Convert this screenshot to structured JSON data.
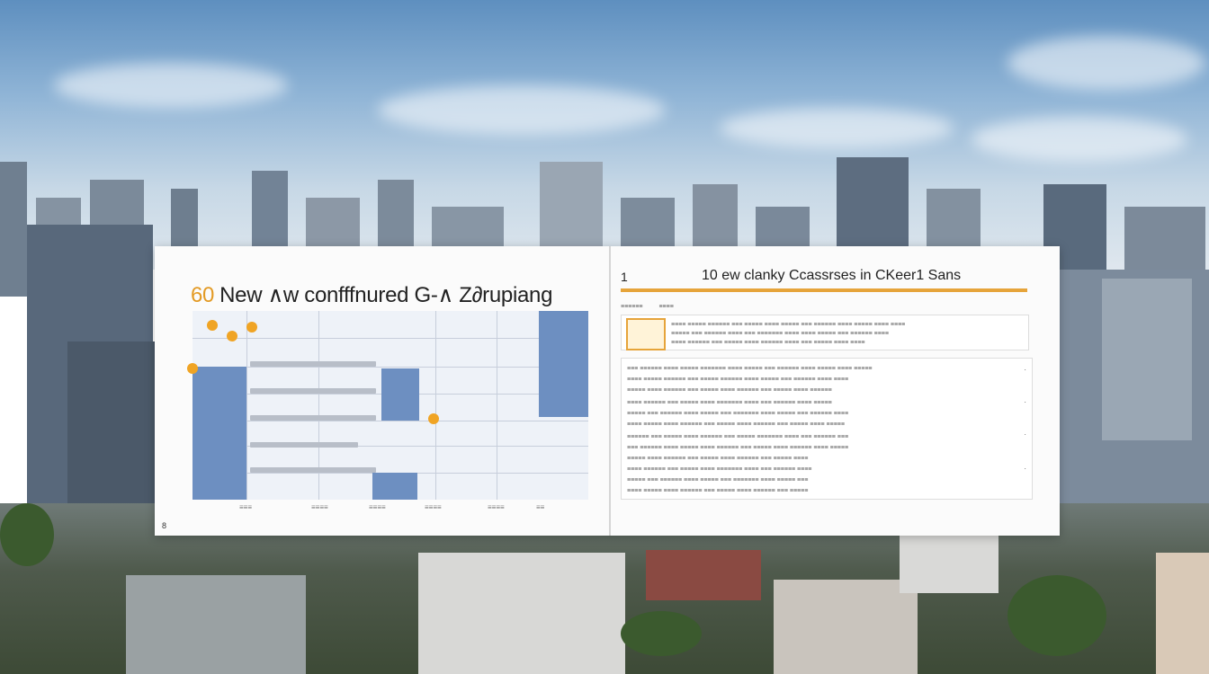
{
  "left_panel": {
    "title_number": "60",
    "title_text": "New ∧w confffnured G-∧ Z∂rupiang",
    "x_ticks": [
      "≡≡≡",
      "≡≡≡≡",
      "≡≡≡≡",
      "≡≡≡≡",
      "≡≡≡≡",
      "≡≡"
    ],
    "footer": "8"
  },
  "right_panel": {
    "section_number": "1",
    "title": "10 ew clanky Ccassrses in CKeer1 Sans",
    "tab_labels": [
      "≡≡≡≡≡≡",
      "≡≡≡≡"
    ],
    "card_lines": [
      "≡≡≡≡ ≡≡≡≡≡ ≡≡≡≡≡≡ ≡≡≡ ≡≡≡≡≡ ≡≡≡≡ ≡≡≡≡≡ ≡≡≡ ≡≡≡≡≡≡ ≡≡≡≡ ≡≡≡≡≡ ≡≡≡≡ ≡≡≡≡",
      "≡≡≡≡≡ ≡≡≡ ≡≡≡≡≡≡ ≡≡≡≡ ≡≡≡ ≡≡≡≡≡≡≡ ≡≡≡≡ ≡≡≡≡ ≡≡≡≡≡ ≡≡≡ ≡≡≡≡≡≡ ≡≡≡≡",
      "≡≡≡≡ ≡≡≡≡≡≡ ≡≡≡ ≡≡≡≡≡ ≡≡≡≡ ≡≡≡≡≡≡ ≡≡≡≡ ≡≡≡ ≡≡≡≡≡ ≡≡≡≡ ≡≡≡≡"
    ],
    "list_rows": [
      "≡≡≡ ≡≡≡≡≡≡ ≡≡≡≡ ≡≡≡≡≡ ≡≡≡≡≡≡≡ ≡≡≡≡ ≡≡≡≡≡ ≡≡≡ ≡≡≡≡≡≡ ≡≡≡≡ ≡≡≡≡≡ ≡≡≡≡ ≡≡≡≡≡",
      "≡≡≡≡ ≡≡≡≡≡ ≡≡≡≡≡≡ ≡≡≡ ≡≡≡≡≡ ≡≡≡≡≡≡ ≡≡≡≡ ≡≡≡≡≡ ≡≡≡ ≡≡≡≡≡≡ ≡≡≡≡ ≡≡≡≡",
      "≡≡≡≡≡ ≡≡≡≡ ≡≡≡≡≡≡ ≡≡≡ ≡≡≡≡≡ ≡≡≡≡ ≡≡≡≡≡≡ ≡≡≡ ≡≡≡≡≡ ≡≡≡≡ ≡≡≡≡≡≡",
      "≡≡≡≡ ≡≡≡≡≡≡ ≡≡≡ ≡≡≡≡≡ ≡≡≡≡ ≡≡≡≡≡≡≡ ≡≡≡≡ ≡≡≡ ≡≡≡≡≡≡ ≡≡≡≡ ≡≡≡≡≡",
      "≡≡≡≡≡ ≡≡≡ ≡≡≡≡≡≡ ≡≡≡≡ ≡≡≡≡≡ ≡≡≡ ≡≡≡≡≡≡≡ ≡≡≡≡ ≡≡≡≡≡ ≡≡≡ ≡≡≡≡≡≡ ≡≡≡≡",
      "≡≡≡≡ ≡≡≡≡≡ ≡≡≡≡ ≡≡≡≡≡≡ ≡≡≡ ≡≡≡≡≡ ≡≡≡≡ ≡≡≡≡≡≡ ≡≡≡ ≡≡≡≡≡ ≡≡≡≡ ≡≡≡≡≡",
      "≡≡≡≡≡≡ ≡≡≡ ≡≡≡≡≡ ≡≡≡≡ ≡≡≡≡≡≡ ≡≡≡ ≡≡≡≡≡ ≡≡≡≡≡≡≡ ≡≡≡≡ ≡≡≡ ≡≡≡≡≡≡ ≡≡≡",
      "≡≡≡ ≡≡≡≡≡≡ ≡≡≡≡ ≡≡≡≡≡ ≡≡≡≡ ≡≡≡≡≡≡ ≡≡≡ ≡≡≡≡≡ ≡≡≡≡ ≡≡≡≡≡≡ ≡≡≡≡ ≡≡≡≡≡",
      "≡≡≡≡≡ ≡≡≡≡ ≡≡≡≡≡≡ ≡≡≡ ≡≡≡≡≡ ≡≡≡≡ ≡≡≡≡≡≡ ≡≡≡ ≡≡≡≡≡ ≡≡≡≡",
      "≡≡≡≡ ≡≡≡≡≡≡ ≡≡≡ ≡≡≡≡≡ ≡≡≡≡ ≡≡≡≡≡≡≡ ≡≡≡≡ ≡≡≡ ≡≡≡≡≡≡ ≡≡≡≡",
      "≡≡≡≡≡ ≡≡≡ ≡≡≡≡≡≡ ≡≡≡≡ ≡≡≡≡≡ ≡≡≡ ≡≡≡≡≡≡≡ ≡≡≡≡ ≡≡≡≡≡ ≡≡≡",
      "≡≡≡≡ ≡≡≡≡≡ ≡≡≡≡ ≡≡≡≡≡≡ ≡≡≡ ≡≡≡≡≡ ≡≡≡≡ ≡≡≡≡≡≡ ≡≡≡ ≡≡≡≡≡"
    ]
  },
  "colors": {
    "accent": "#e6a43a",
    "chart_bar": "#6d8fc1",
    "marker": "#f0a424"
  }
}
